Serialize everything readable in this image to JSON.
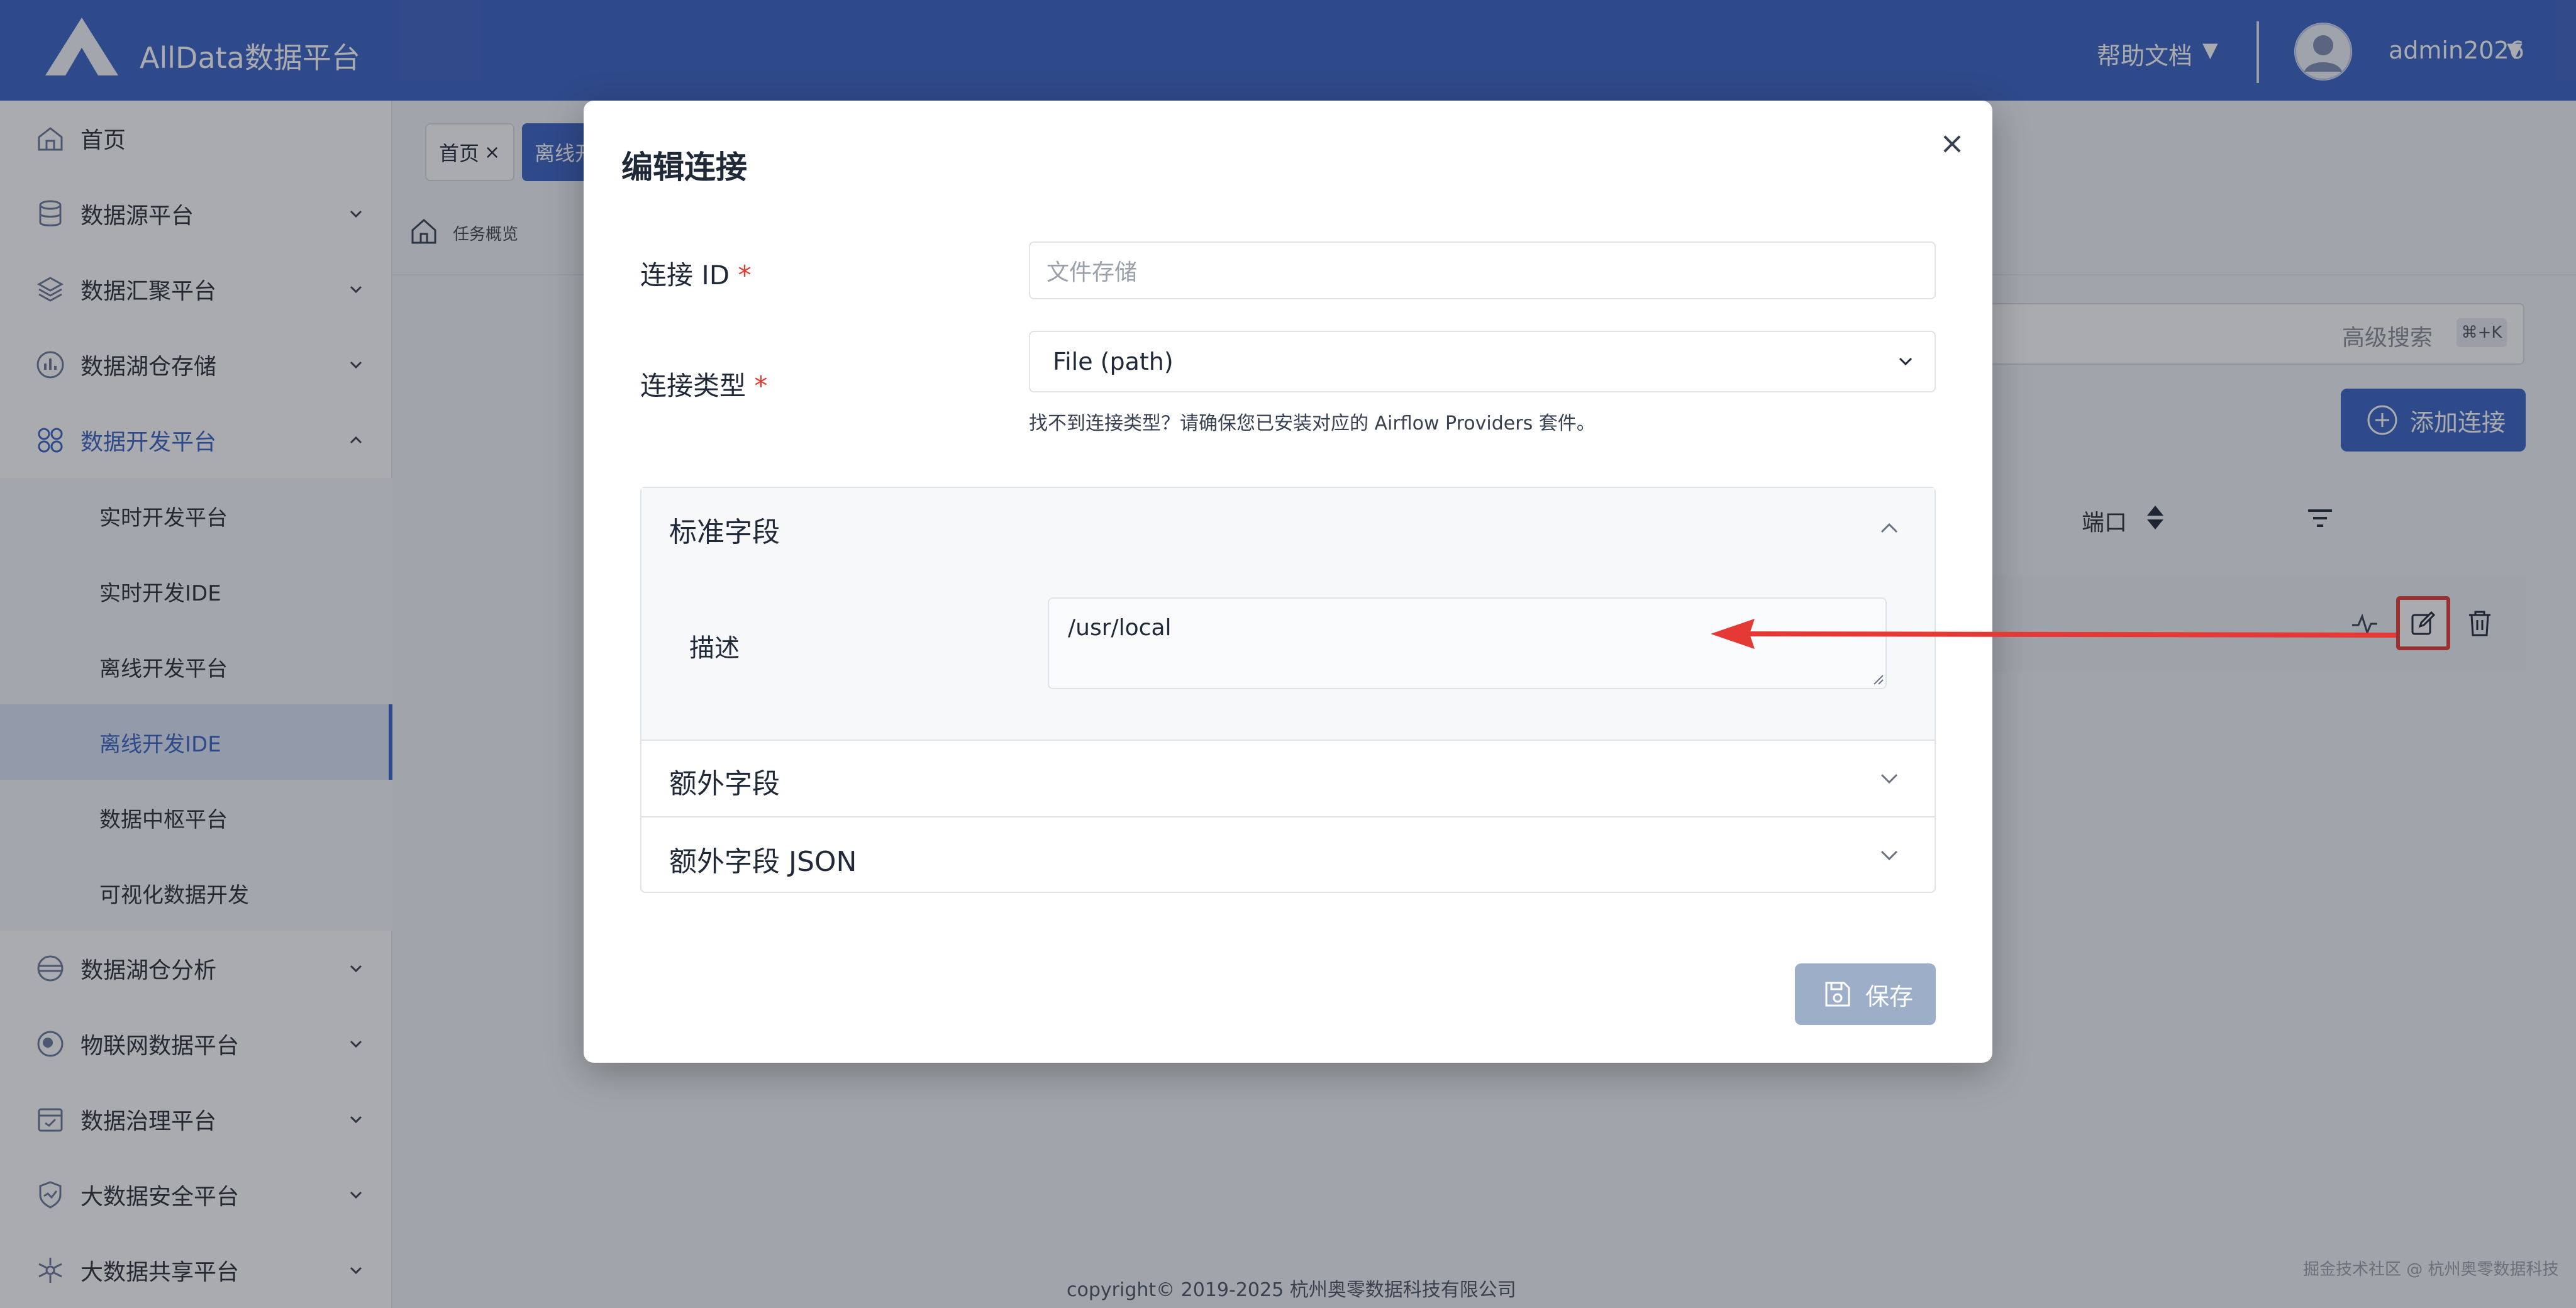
{
  "app": {
    "brand": "AllData数据平台"
  },
  "header": {
    "help_label": "帮助文档",
    "username": "admin2026"
  },
  "sidebar": {
    "items": [
      {
        "label": "首页"
      },
      {
        "label": "数据源平台"
      },
      {
        "label": "数据汇聚平台"
      },
      {
        "label": "数据湖仓存储"
      },
      {
        "label": "数据开发平台"
      },
      {
        "label": "数据湖仓分析"
      },
      {
        "label": "物联网数据平台"
      },
      {
        "label": "数据治理平台"
      },
      {
        "label": "大数据安全平台"
      },
      {
        "label": "大数据共享平台"
      }
    ],
    "sub_items": [
      {
        "label": "实时开发平台"
      },
      {
        "label": "实时开发IDE"
      },
      {
        "label": "离线开发平台"
      },
      {
        "label": "离线开发IDE"
      },
      {
        "label": "数据中枢平台"
      },
      {
        "label": "可视化数据开发"
      }
    ]
  },
  "tabs": {
    "home": "首页",
    "active": "离线开"
  },
  "breadcrumb": {
    "current": "任务概览"
  },
  "page": {
    "advanced_search": "高级搜索",
    "shortcut": "⌘+K",
    "add_connection": "添加连接",
    "column_port": "端口"
  },
  "modal": {
    "title": "编辑连接",
    "close": "×",
    "conn_id_label": "连接 ID",
    "conn_id_placeholder": "文件存储",
    "conn_type_label": "连接类型",
    "conn_type_value": "File (path)",
    "conn_type_hint": "找不到连接类型？请确保您已安装对应的 Airflow Providers 套件。",
    "required_mark": "*",
    "sections": {
      "standard": "标准字段",
      "extra": "额外字段",
      "extra_json": "额外字段 JSON"
    },
    "description_label": "描述",
    "description_value": "/usr/local",
    "save": "保存"
  },
  "footer": {
    "copyright": "copyright© 2019-2025 杭州奥零数据科技有限公司",
    "watermark": "掘金技术社区 @ 杭州奥零数据科技"
  },
  "colors": {
    "primary": "#3b63c4",
    "annotation": "#e53935"
  }
}
